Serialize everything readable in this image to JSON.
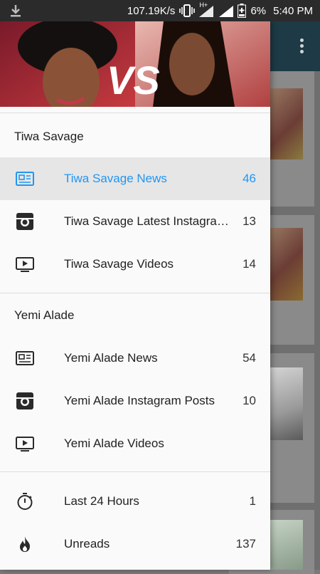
{
  "status_bar": {
    "network_speed": "107.19K/s",
    "battery": "6%",
    "time": "5:40 PM",
    "network_type": "H+"
  },
  "header": {
    "vs_text": "VS"
  },
  "sections": [
    {
      "title": "Tiwa Savage",
      "items": [
        {
          "label": "Tiwa Savage News",
          "count": "46",
          "icon": "newspaper-icon",
          "active": true
        },
        {
          "label": "Tiwa Savage Latest Instagram Posts",
          "count": "13",
          "icon": "instagram-icon"
        },
        {
          "label": "Tiwa Savage Videos",
          "count": "14",
          "icon": "video-icon"
        }
      ]
    },
    {
      "title": "Yemi Alade",
      "items": [
        {
          "label": "Yemi Alade News",
          "count": "54",
          "icon": "newspaper-icon"
        },
        {
          "label": "Yemi Alade Instagram Posts",
          "count": "10",
          "icon": "instagram-icon"
        },
        {
          "label": "Yemi Alade Videos",
          "count": "",
          "icon": "video-icon"
        }
      ]
    }
  ],
  "extras": [
    {
      "label": "Last 24 Hours",
      "count": "1",
      "icon": "timer-icon"
    },
    {
      "label": "Unreads",
      "count": "137",
      "icon": "fire-icon"
    }
  ],
  "colors": {
    "accent": "#2196f3",
    "toolbar": "#1d3a46"
  }
}
